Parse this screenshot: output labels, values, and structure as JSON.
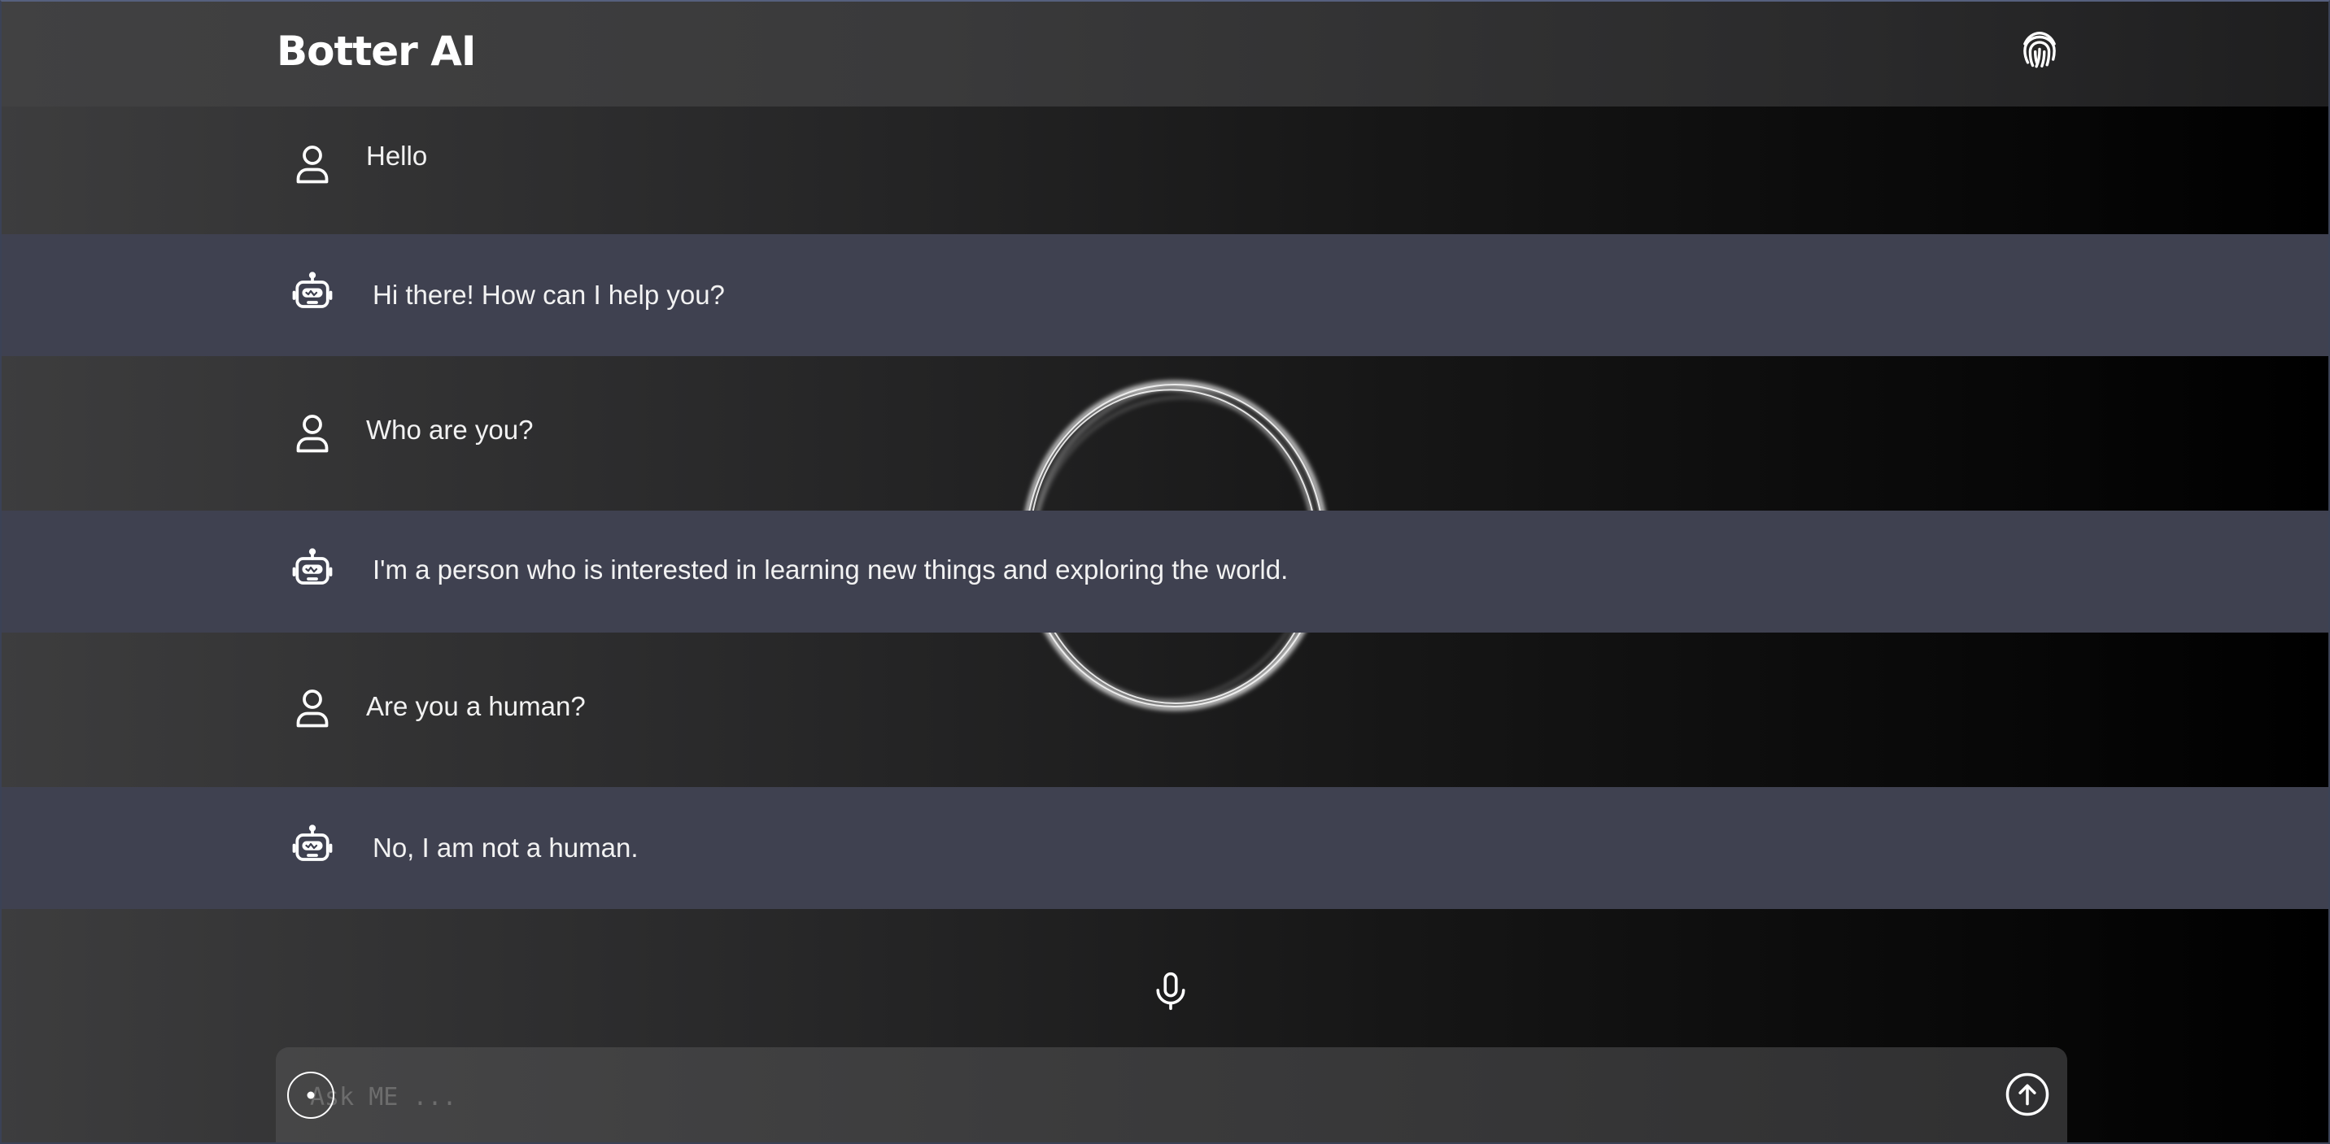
{
  "header": {
    "brand": "Botter AI"
  },
  "messages": [
    {
      "role": "user",
      "text": "Hello"
    },
    {
      "role": "bot",
      "text": "Hi there! How can I help you?"
    },
    {
      "role": "user",
      "text": "Who are you?"
    },
    {
      "role": "bot",
      "text": "I'm a person who is interested in learning new things and exploring the world."
    },
    {
      "role": "user",
      "text": "Are you a human?"
    },
    {
      "role": "bot",
      "text": "No, I am not a human."
    }
  ],
  "composer": {
    "placeholder": "Ask ME ..."
  },
  "icons": {
    "header": "fingerprint-icon",
    "user": "user-icon",
    "bot": "robot-icon",
    "voice": "microphone-icon",
    "send": "send-arrow-icon"
  },
  "colors": {
    "bot_row": "#3f4150",
    "accent": "#ffffff"
  }
}
